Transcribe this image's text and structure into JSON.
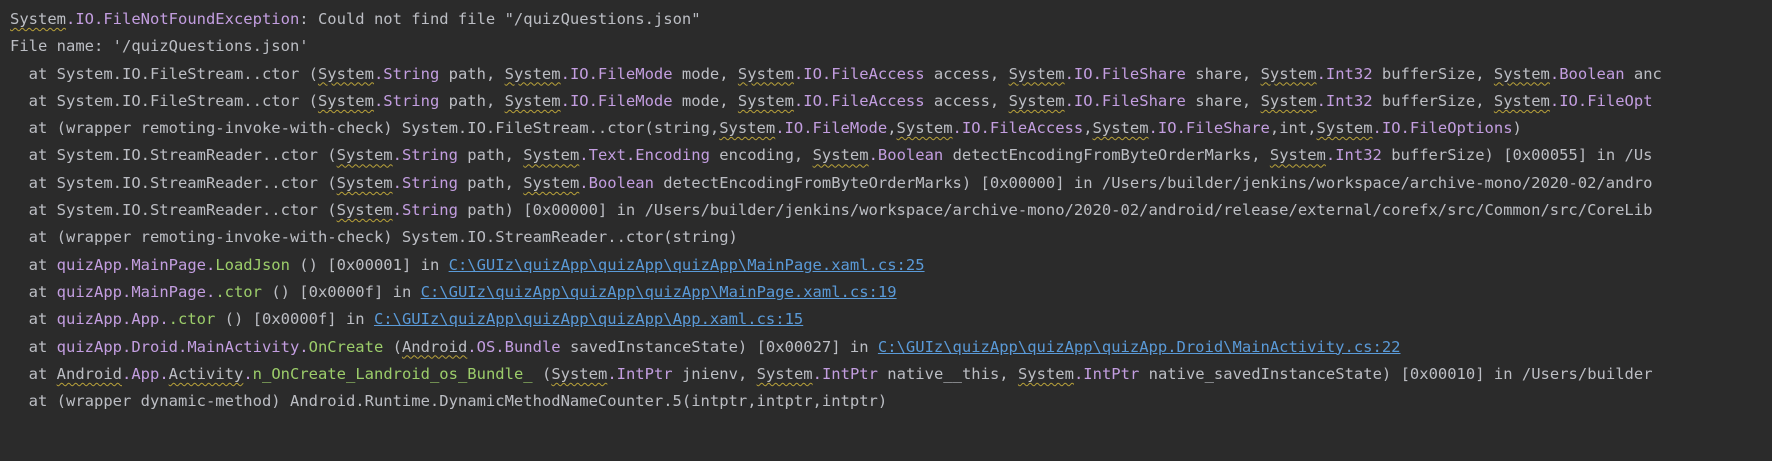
{
  "console": {
    "lines": [
      [
        {
          "t": "System",
          "c": "squig"
        },
        {
          "t": ".IO.FileNotFoundException",
          "c": "purple"
        },
        {
          "t": ": Could not find file \"/quizQuestions.json\""
        }
      ],
      [
        {
          "t": "File name: '/quizQuestions.json'"
        }
      ],
      [
        {
          "t": "  at System.IO.FileStream..ctor ("
        },
        {
          "t": "System",
          "c": "squig"
        },
        {
          "t": ".String",
          "c": "purple"
        },
        {
          "t": " path, "
        },
        {
          "t": "System",
          "c": "squig"
        },
        {
          "t": ".IO.FileMode",
          "c": "purple"
        },
        {
          "t": " mode, "
        },
        {
          "t": "System",
          "c": "squig"
        },
        {
          "t": ".IO.FileAccess",
          "c": "purple"
        },
        {
          "t": " access, "
        },
        {
          "t": "System",
          "c": "squig"
        },
        {
          "t": ".IO.FileShare",
          "c": "purple"
        },
        {
          "t": " share, "
        },
        {
          "t": "System",
          "c": "squig"
        },
        {
          "t": ".Int32",
          "c": "purple"
        },
        {
          "t": " bufferSize, "
        },
        {
          "t": "System",
          "c": "squig"
        },
        {
          "t": ".Boolean",
          "c": "purple"
        },
        {
          "t": " anc"
        }
      ],
      [
        {
          "t": "  at System.IO.FileStream..ctor ("
        },
        {
          "t": "System",
          "c": "squig"
        },
        {
          "t": ".String",
          "c": "purple"
        },
        {
          "t": " path, "
        },
        {
          "t": "System",
          "c": "squig"
        },
        {
          "t": ".IO.FileMode",
          "c": "purple"
        },
        {
          "t": " mode, "
        },
        {
          "t": "System",
          "c": "squig"
        },
        {
          "t": ".IO.FileAccess",
          "c": "purple"
        },
        {
          "t": " access, "
        },
        {
          "t": "System",
          "c": "squig"
        },
        {
          "t": ".IO.FileShare",
          "c": "purple"
        },
        {
          "t": " share, "
        },
        {
          "t": "System",
          "c": "squig"
        },
        {
          "t": ".Int32",
          "c": "purple"
        },
        {
          "t": " bufferSize, "
        },
        {
          "t": "System",
          "c": "squig"
        },
        {
          "t": ".IO.FileOpt",
          "c": "purple"
        }
      ],
      [
        {
          "t": "  at (wrapper remoting-invoke-with-check) System.IO.FileStream..ctor(string,"
        },
        {
          "t": "System",
          "c": "squig"
        },
        {
          "t": ".IO.FileMode",
          "c": "purple"
        },
        {
          "t": ","
        },
        {
          "t": "System",
          "c": "squig"
        },
        {
          "t": ".IO.FileAccess",
          "c": "purple"
        },
        {
          "t": ","
        },
        {
          "t": "System",
          "c": "squig"
        },
        {
          "t": ".IO.FileShare",
          "c": "purple"
        },
        {
          "t": ",int,"
        },
        {
          "t": "System",
          "c": "squig"
        },
        {
          "t": ".IO.FileOptions",
          "c": "purple"
        },
        {
          "t": ")"
        }
      ],
      [
        {
          "t": "  at System.IO.StreamReader..ctor ("
        },
        {
          "t": "System",
          "c": "squig"
        },
        {
          "t": ".String",
          "c": "purple"
        },
        {
          "t": " path, "
        },
        {
          "t": "System",
          "c": "squig"
        },
        {
          "t": ".Text.Encoding",
          "c": "purple"
        },
        {
          "t": " encoding, "
        },
        {
          "t": "System",
          "c": "squig"
        },
        {
          "t": ".Boolean",
          "c": "purple"
        },
        {
          "t": " detectEncodingFromByteOrderMarks, "
        },
        {
          "t": "System",
          "c": "squig"
        },
        {
          "t": ".Int32",
          "c": "purple"
        },
        {
          "t": " bufferSize) [0x00055] in /Us"
        }
      ],
      [
        {
          "t": "  at System.IO.StreamReader..ctor ("
        },
        {
          "t": "System",
          "c": "squig"
        },
        {
          "t": ".String",
          "c": "purple"
        },
        {
          "t": " path, "
        },
        {
          "t": "System",
          "c": "squig"
        },
        {
          "t": ".Boolean",
          "c": "purple"
        },
        {
          "t": " detectEncodingFromByteOrderMarks) [0x00000] in /Users/builder/jenkins/workspace/archive-mono/2020-02/andro"
        }
      ],
      [
        {
          "t": "  at System.IO.StreamReader..ctor ("
        },
        {
          "t": "System",
          "c": "squig"
        },
        {
          "t": ".String",
          "c": "purple"
        },
        {
          "t": " path) [0x00000] in /Users/builder/jenkins/workspace/archive-mono/2020-02/android/release/external/corefx/src/Common/src/CoreLib"
        }
      ],
      [
        {
          "t": "  at (wrapper remoting-invoke-with-check) System.IO.StreamReader..ctor(string)"
        }
      ],
      [
        {
          "t": "  at "
        },
        {
          "t": "quizApp.MainPage.",
          "c": "purple"
        },
        {
          "t": "LoadJson",
          "c": "green"
        },
        {
          "t": " () [0x00001] in "
        },
        {
          "t": "C:\\GUIz\\quizApp\\quizApp\\quizApp\\MainPage.xaml.cs:25",
          "c": "link"
        }
      ],
      [
        {
          "t": "  at "
        },
        {
          "t": "quizApp.MainPage.",
          "c": "purple"
        },
        {
          "t": ".ctor",
          "c": "green"
        },
        {
          "t": " () [0x0000f] in "
        },
        {
          "t": "C:\\GUIz\\quizApp\\quizApp\\quizApp\\MainPage.xaml.cs:19",
          "c": "link"
        }
      ],
      [
        {
          "t": "  at "
        },
        {
          "t": "quizApp.App.",
          "c": "purple"
        },
        {
          "t": ".ctor",
          "c": "green"
        },
        {
          "t": " () [0x0000f] in "
        },
        {
          "t": "C:\\GUIz\\quizApp\\quizApp\\quizApp\\App.xaml.cs:15",
          "c": "link"
        }
      ],
      [
        {
          "t": "  at "
        },
        {
          "t": "quizApp.Droid.MainActivity.",
          "c": "purple"
        },
        {
          "t": "OnCreate",
          "c": "green"
        },
        {
          "t": " ("
        },
        {
          "t": "Android",
          "c": "squig"
        },
        {
          "t": ".OS.Bundle",
          "c": "purple"
        },
        {
          "t": " savedInstanceState) [0x00027] in "
        },
        {
          "t": "C:\\GUIz\\quizApp\\quizApp\\quizApp.Droid\\MainActivity.cs:22",
          "c": "link"
        }
      ],
      [
        {
          "t": "  at "
        },
        {
          "t": "Android",
          "c": "squig"
        },
        {
          "t": ".App.",
          "c": "purple"
        },
        {
          "t": "Activity",
          "c": "squig"
        },
        {
          "t": ".",
          "c": "purple"
        },
        {
          "t": "n_OnCreate_Landroid_os_Bundle_",
          "c": "green"
        },
        {
          "t": " ("
        },
        {
          "t": "System",
          "c": "squig"
        },
        {
          "t": ".IntPtr",
          "c": "purple"
        },
        {
          "t": " jnienv, "
        },
        {
          "t": "System",
          "c": "squig"
        },
        {
          "t": ".IntPtr",
          "c": "purple"
        },
        {
          "t": " native__this, "
        },
        {
          "t": "System",
          "c": "squig"
        },
        {
          "t": ".IntPtr",
          "c": "purple"
        },
        {
          "t": " native_savedInstanceState) [0x00010] in /Users/builder"
        }
      ],
      [
        {
          "t": "  at (wrapper dynamic-method) Android.Runtime.DynamicMethodNameCounter.5(intptr,intptr,intptr)"
        }
      ]
    ]
  }
}
